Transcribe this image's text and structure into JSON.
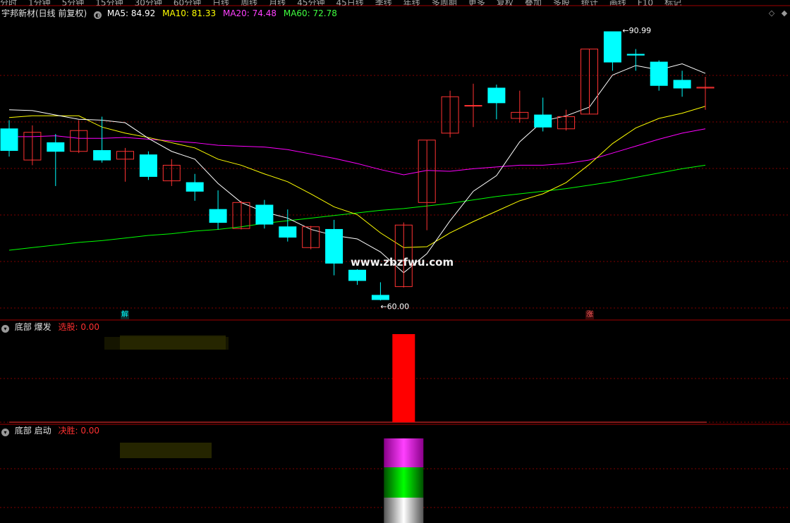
{
  "top_menu": [
    "分时",
    "1分钟",
    "5分钟",
    "15分钟",
    "30分钟",
    "60分钟",
    "日线",
    "周线",
    "月线",
    "45分钟",
    "45日线",
    "季线",
    "年线",
    "多周期",
    "更多",
    "复权",
    "叠加",
    "多股",
    "统计",
    "画线",
    "F10",
    "标记"
  ],
  "main_panel": {
    "stock_title": "宇邦新材(日线 前复权)",
    "ma5": "MA5: 84.92",
    "ma10": "MA10: 81.33",
    "ma20": "MA20: 74.48",
    "ma60": "MA60: 72.78",
    "high_label": "90.99",
    "low_label": "60.00",
    "marker_jie": "解",
    "marker_zhang": "涨",
    "watermark": "www.zbzfwu.com"
  },
  "panel1": {
    "title": "底部 爆发",
    "indicator": "选股: 0.00"
  },
  "panel2": {
    "title": "底部 启动",
    "indicator": "决胜: 0.00"
  },
  "colors": {
    "up": "#ff3232",
    "down": "#00ffff",
    "ma5": "#ffffff",
    "ma10": "#ffff00",
    "ma20": "#ff00ff",
    "ma60": "#00ff00",
    "grid": "#7f0000"
  },
  "chart_data": {
    "type": "candlestick",
    "candles": [
      {
        "o": 79.8,
        "h": 80.8,
        "l": 76.6,
        "c": 77.3
      },
      {
        "o": 76.2,
        "h": 80.2,
        "l": 75.6,
        "c": 79.4
      },
      {
        "o": 78.2,
        "h": 79.2,
        "l": 73.2,
        "c": 77.2
      },
      {
        "o": 77.2,
        "h": 80.8,
        "l": 77.0,
        "c": 79.6
      },
      {
        "o": 77.3,
        "h": 81.2,
        "l": 75.9,
        "c": 76.2
      },
      {
        "o": 76.3,
        "h": 77.6,
        "l": 73.7,
        "c": 77.2
      },
      {
        "o": 76.8,
        "h": 77.2,
        "l": 73.9,
        "c": 74.3
      },
      {
        "o": 73.8,
        "h": 76.3,
        "l": 73.2,
        "c": 75.6
      },
      {
        "o": 73.6,
        "h": 74.6,
        "l": 71.5,
        "c": 72.6
      },
      {
        "o": 70.5,
        "h": 72.7,
        "l": 68.2,
        "c": 69.0
      },
      {
        "o": 68.3,
        "h": 71.5,
        "l": 68.2,
        "c": 71.3
      },
      {
        "o": 71.0,
        "h": 71.6,
        "l": 68.3,
        "c": 68.8
      },
      {
        "o": 68.5,
        "h": 70.5,
        "l": 66.8,
        "c": 67.3
      },
      {
        "o": 66.1,
        "h": 68.6,
        "l": 65.9,
        "c": 68.5
      },
      {
        "o": 68.2,
        "h": 69.3,
        "l": 62.9,
        "c": 64.3
      },
      {
        "o": 63.5,
        "h": 63.6,
        "l": 61.8,
        "c": 62.3
      },
      {
        "o": 60.6,
        "h": 62.1,
        "l": 60.0,
        "c": 60.1
      },
      {
        "o": 61.6,
        "h": 69.0,
        "l": 61.5,
        "c": 68.7
      },
      {
        "o": 71.3,
        "h": 78.5,
        "l": 68.1,
        "c": 78.5
      },
      {
        "o": 79.3,
        "h": 84.2,
        "l": 78.8,
        "c": 83.5
      },
      {
        "o": 82.5,
        "h": 85.0,
        "l": 80.0,
        "c": 82.5
      },
      {
        "o": 84.5,
        "h": 84.9,
        "l": 80.9,
        "c": 82.8
      },
      {
        "o": 81.0,
        "h": 84.2,
        "l": 80.5,
        "c": 81.7
      },
      {
        "o": 81.4,
        "h": 83.4,
        "l": 79.5,
        "c": 80.0
      },
      {
        "o": 79.8,
        "h": 82.0,
        "l": 79.6,
        "c": 81.2
      },
      {
        "o": 81.5,
        "h": 89.0,
        "l": 81.5,
        "c": 89.0
      },
      {
        "o": 91.0,
        "h": 91.0,
        "l": 86.5,
        "c": 87.5
      },
      {
        "o": 88.4,
        "h": 89.0,
        "l": 86.5,
        "c": 88.3
      },
      {
        "o": 87.5,
        "h": 87.7,
        "l": 84.2,
        "c": 84.8
      },
      {
        "o": 85.4,
        "h": 86.5,
        "l": 83.5,
        "c": 84.5
      },
      {
        "o": 84.5,
        "h": 85.8,
        "l": 82.0,
        "c": 84.6
      }
    ],
    "ma5": [
      82.0,
      81.9,
      81.4,
      80.9,
      80.8,
      80.5,
      78.7,
      77.2,
      76.3,
      73.5,
      71.3,
      70.2,
      69.5,
      68.2,
      67.5,
      67.1,
      65.6,
      63.2,
      65.4,
      69.2,
      72.6,
      74.4,
      78.3,
      80.7,
      81.3,
      82.3,
      86.0,
      87.1,
      86.6,
      87.3,
      86.2
    ],
    "ma10": [
      81.1,
      81.3,
      81.3,
      81.3,
      80.0,
      79.3,
      78.8,
      78.2,
      77.6,
      76.3,
      75.6,
      74.6,
      73.7,
      72.3,
      70.8,
      69.9,
      67.8,
      66.1,
      66.2,
      67.8,
      69.1,
      70.3,
      71.5,
      72.3,
      73.6,
      75.7,
      78.1,
      79.9,
      81.0,
      81.6,
      82.4
    ],
    "ma20": [
      78.9,
      78.9,
      79.0,
      78.7,
      78.7,
      78.8,
      78.6,
      78.4,
      78.2,
      77.9,
      77.8,
      77.7,
      77.4,
      76.9,
      76.4,
      75.8,
      75.1,
      74.5,
      75.0,
      74.9,
      75.2,
      75.4,
      75.6,
      75.6,
      75.8,
      76.2,
      77.0,
      77.8,
      78.6,
      79.3,
      79.8
    ],
    "ma60": [
      65.8,
      66.1,
      66.4,
      66.7,
      66.9,
      67.2,
      67.5,
      67.7,
      68.0,
      68.2,
      68.5,
      68.9,
      69.2,
      69.5,
      69.8,
      70.1,
      70.4,
      70.6,
      70.9,
      71.2,
      71.6,
      72.0,
      72.3,
      72.6,
      72.9,
      73.3,
      73.7,
      74.2,
      74.7,
      75.2,
      75.6
    ],
    "high": {
      "value": 90.99,
      "index": 26
    },
    "low": {
      "value": 60.0,
      "index": 16
    },
    "panel1_bar_index": 17,
    "panel2_bar_index": 17
  }
}
